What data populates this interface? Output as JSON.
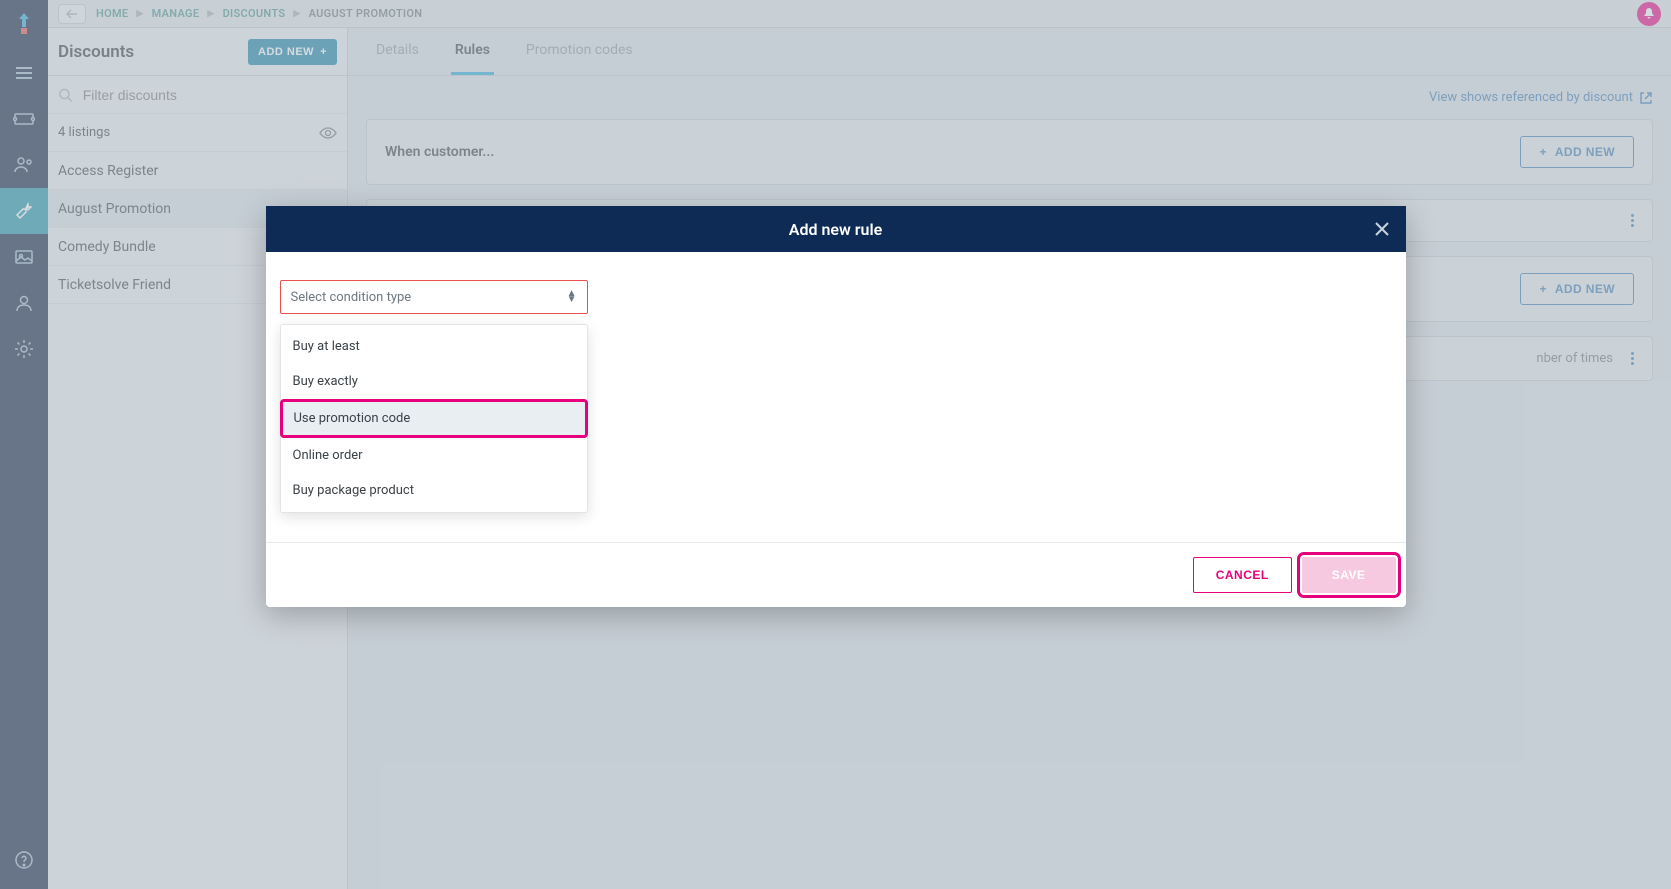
{
  "breadcrumbs": {
    "home": "HOME",
    "manage": "MANAGE",
    "discounts": "DISCOUNTS",
    "current": "AUGUST PROMOTION"
  },
  "sidebar": {
    "title": "Discounts",
    "add_new": "ADD NEW",
    "filter_placeholder": "Filter discounts",
    "count_label": "4 listings",
    "items": [
      {
        "label": "Access Register"
      },
      {
        "label": "August Promotion"
      },
      {
        "label": "Comedy Bundle"
      },
      {
        "label": "Ticketsolve Friend"
      }
    ]
  },
  "tabs": {
    "details": "Details",
    "rules": "Rules",
    "promo": "Promotion codes"
  },
  "external_link": "View shows referenced by discount",
  "panels": {
    "when_customer": "When customer...",
    "add_new": "ADD NEW",
    "nob_times_fragment": "nber of times"
  },
  "modal": {
    "title": "Add new rule",
    "select_placeholder": "Select condition type",
    "options": [
      "Buy at least",
      "Buy exactly",
      "Use promotion code",
      "Online order",
      "Buy package product"
    ],
    "cancel": "CANCEL",
    "save": "SAVE"
  }
}
